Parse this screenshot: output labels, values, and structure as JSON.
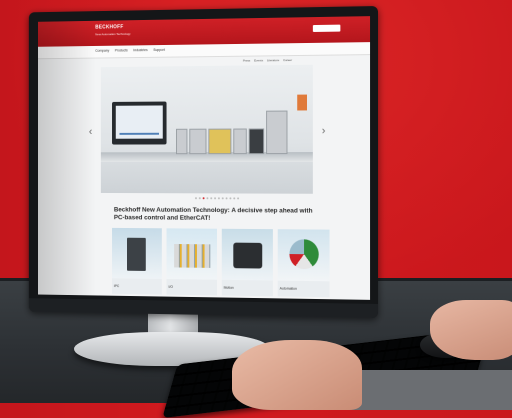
{
  "site": {
    "logo": "BECKHOFF",
    "tagline": "New Automation Technology",
    "top_links": [
      "",
      ""
    ],
    "nav": [
      "Company",
      "Products",
      "Industries",
      "Support"
    ],
    "subnav": [
      "Press",
      "Events",
      "Literature",
      "Career"
    ]
  },
  "hero": {
    "prev_glyph": "‹",
    "next_glyph": "›",
    "slide_count": 12,
    "active_slide": 2
  },
  "headline": "Beckhoff New Automation Technology: A decisive step ahead with PC-based control and EtherCAT!",
  "cards": [
    {
      "label": "IPC"
    },
    {
      "label": "I/O"
    },
    {
      "label": "Motion"
    },
    {
      "label": "Automation"
    }
  ],
  "colors": {
    "brand_red": "#cf2026",
    "wall_red": "#c4161c"
  }
}
